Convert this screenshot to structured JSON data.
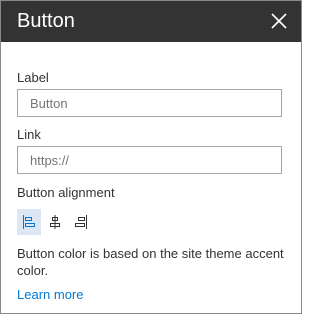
{
  "panel": {
    "title": "Button",
    "close_icon": "close-icon"
  },
  "label_field": {
    "label": "Label",
    "value": "",
    "placeholder": "Button"
  },
  "link_field": {
    "label": "Link",
    "value": "",
    "placeholder": "https://"
  },
  "alignment": {
    "label": "Button alignment",
    "options": [
      {
        "icon": "align-left-icon",
        "selected": true
      },
      {
        "icon": "align-center-icon",
        "selected": false
      },
      {
        "icon": "align-right-icon",
        "selected": false
      }
    ]
  },
  "note": "Button color is based on the site theme accent color.",
  "learn_more": "Learn more",
  "colors": {
    "header_bg": "#333333",
    "accent": "#0078d4",
    "selected_bg": "#dde7f3"
  }
}
